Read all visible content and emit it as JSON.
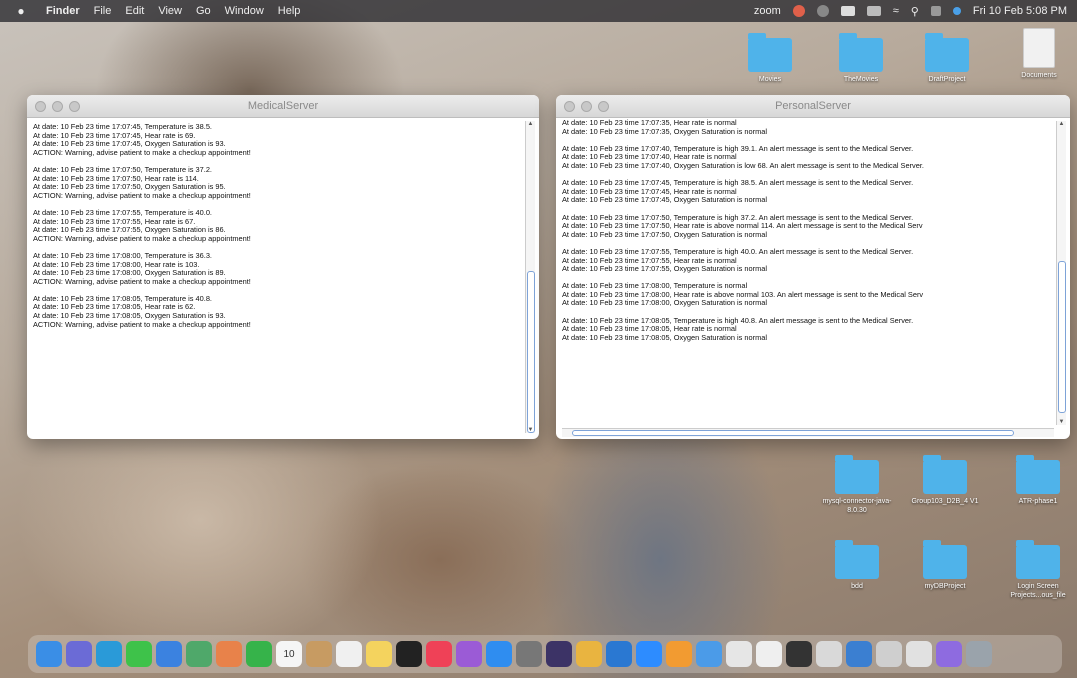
{
  "menubar": {
    "apple": "",
    "items": [
      "Finder",
      "File",
      "Edit",
      "View",
      "Go",
      "Window",
      "Help"
    ],
    "zoom_label": "zoom",
    "clock": "Fri 10 Feb 5:08 PM"
  },
  "medical_window": {
    "title": "MedicalServer",
    "blocks": [
      [
        "At date: 10 Feb 23 time 17:07:45, Temperature is 38.5.",
        "At date: 10 Feb 23 time 17:07:45, Hear rate is 69.",
        "At date: 10 Feb 23 time 17:07:45, Oxygen Saturation is 93.",
        "ACTION: Warning, advise patient to make a checkup appointment!"
      ],
      [
        "At date: 10 Feb 23 time 17:07:50, Temperature is 37.2.",
        "At date: 10 Feb 23 time 17:07:50, Hear rate is 114.",
        "At date: 10 Feb 23 time 17:07:50, Oxygen Saturation is 95.",
        "ACTION: Warning, advise patient to make a checkup appointment!"
      ],
      [
        "At date: 10 Feb 23 time 17:07:55, Temperature is 40.0.",
        "At date: 10 Feb 23 time 17:07:55, Hear rate is 67.",
        "At date: 10 Feb 23 time 17:07:55, Oxygen Saturation is 86.",
        "ACTION: Warning, advise patient to make a checkup appointment!"
      ],
      [
        "At date: 10 Feb 23 time 17:08:00, Temperature is 36.3.",
        "At date: 10 Feb 23 time 17:08:00, Hear rate is 103.",
        "At date: 10 Feb 23 time 17:08:00, Oxygen Saturation is 89.",
        "ACTION: Warning, advise patient to make a checkup appointment!"
      ],
      [
        "At date: 10 Feb 23 time 17:08:05, Temperature is 40.8.",
        "At date: 10 Feb 23 time 17:08:05, Hear rate is 62.",
        "At date: 10 Feb 23 time 17:08:05, Oxygen Saturation is 93.",
        "ACTION: Warning, advise patient to make a checkup appointment!"
      ]
    ]
  },
  "personal_window": {
    "title": "PersonalServer",
    "blocks": [
      [
        "At date: 10 Feb 23 time 17:07:35, Hear rate is normal",
        "At date: 10 Feb 23 time 17:07:35, Oxygen Saturation is normal"
      ],
      [
        "At date: 10 Feb 23 time 17:07:40, Temperature is high 39.1. An alert message is sent to the Medical Server.",
        "At date: 10 Feb 23 time 17:07:40, Hear rate is normal",
        "At date: 10 Feb 23 time 17:07:40, Oxygen Saturation is low 68. An alert message is sent to the Medical Server."
      ],
      [
        "At date: 10 Feb 23 time 17:07:45, Temperature is high 38.5. An alert message is sent to the Medical Server.",
        "At date: 10 Feb 23 time 17:07:45, Hear rate is normal",
        "At date: 10 Feb 23 time 17:07:45, Oxygen Saturation is normal"
      ],
      [
        "At date: 10 Feb 23 time 17:07:50, Temperature is high 37.2. An alert message is sent to the Medical Server.",
        "At date: 10 Feb 23 time 17:07:50, Hear rate is above normal 114. An alert message is sent to the Medical Serv",
        "At date: 10 Feb 23 time 17:07:50, Oxygen Saturation is normal"
      ],
      [
        "At date: 10 Feb 23 time 17:07:55, Temperature is high 40.0. An alert message is sent to the Medical Server.",
        "At date: 10 Feb 23 time 17:07:55, Hear rate is normal",
        "At date: 10 Feb 23 time 17:07:55, Oxygen Saturation is normal"
      ],
      [
        "At date: 10 Feb 23 time 17:08:00, Temperature is normal",
        "At date: 10 Feb 23 time 17:08:00, Hear rate is above normal 103. An alert message is sent to the Medical Serv",
        "At date: 10 Feb 23 time 17:08:00, Oxygen Saturation is normal"
      ],
      [
        "At date: 10 Feb 23 time 17:08:05, Temperature is high 40.8. An alert message is sent to the Medical Server.",
        "At date: 10 Feb 23 time 17:08:05, Hear rate is normal",
        "At date: 10 Feb 23 time 17:08:05, Oxygen Saturation is normal"
      ]
    ]
  },
  "desktop_items": [
    {
      "label": "Movies",
      "icon": "folder-icon"
    },
    {
      "label": "TheMovies",
      "icon": "folder-icon"
    },
    {
      "label": "DraftProject",
      "icon": "folder-icon"
    },
    {
      "label": "Documents",
      "icon": "document-icon"
    },
    {
      "label": "mysql-connector-java-8.0.30",
      "icon": "folder-icon"
    },
    {
      "label": "Group103_D2B_4 V1",
      "icon": "folder-icon"
    },
    {
      "label": "ATR-phase1",
      "icon": "folder-icon"
    },
    {
      "label": "bdd",
      "icon": "folder-icon"
    },
    {
      "label": "myDBProject",
      "icon": "folder-icon"
    },
    {
      "label": "Login Screen Projects...ous_file",
      "icon": "folder-icon"
    }
  ],
  "dock": {
    "calendar_day": "10",
    "icons": [
      {
        "name": "finder-icon",
        "color": "#3a8ee6"
      },
      {
        "name": "launchpad-icon",
        "color": "#6b6bd6"
      },
      {
        "name": "safari-icon",
        "color": "#2a9ad8"
      },
      {
        "name": "messages-icon",
        "color": "#3ec24a"
      },
      {
        "name": "mail-icon",
        "color": "#3b82e0"
      },
      {
        "name": "maps-icon",
        "color": "#4fa86a"
      },
      {
        "name": "photos-icon",
        "color": "#e8824a"
      },
      {
        "name": "facetime-icon",
        "color": "#36b34a"
      },
      {
        "name": "calendar-icon",
        "color": "#f5f5f5"
      },
      {
        "name": "contacts-icon",
        "color": "#c79b62"
      },
      {
        "name": "reminders-icon",
        "color": "#f0f0f0"
      },
      {
        "name": "notes-icon",
        "color": "#f4d35e"
      },
      {
        "name": "tv-icon",
        "color": "#222222"
      },
      {
        "name": "music-icon",
        "color": "#ef4157"
      },
      {
        "name": "podcasts-icon",
        "color": "#9b5bd6"
      },
      {
        "name": "app-store-icon",
        "color": "#2f8df0"
      },
      {
        "name": "system-preferences-icon",
        "color": "#777777"
      },
      {
        "name": "eclipse-icon",
        "color": "#3c3366"
      },
      {
        "name": "chrome-icon",
        "color": "#e9b440"
      },
      {
        "name": "vscode-icon",
        "color": "#2a78d2"
      },
      {
        "name": "zoom-icon",
        "color": "#2d8cff"
      },
      {
        "name": "sublime-icon",
        "color": "#f29b31"
      },
      {
        "name": "xcode-icon",
        "color": "#4b9be8"
      },
      {
        "name": "preview-icon",
        "color": "#e6e6e6"
      },
      {
        "name": "textedit-icon",
        "color": "#efefef"
      },
      {
        "name": "terminal-icon",
        "color": "#333333"
      },
      {
        "name": "java-icon",
        "color": "#d9d9d9"
      },
      {
        "name": "downloads-icon",
        "color": "#3b7fd1"
      },
      {
        "name": "screenshot-icon",
        "color": "#cfcfcf"
      },
      {
        "name": "recent-doc-icon",
        "color": "#e1e1e1"
      },
      {
        "name": "siri-icon",
        "color": "#8e6be0"
      },
      {
        "name": "trash-icon",
        "color": "#9aa3ab"
      }
    ]
  }
}
